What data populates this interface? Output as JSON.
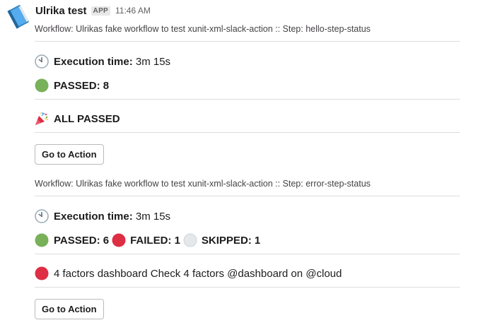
{
  "header": {
    "sender": "Ulrika test",
    "badge": "APP",
    "timestamp": "11:46 AM"
  },
  "sections": [
    {
      "context": "Workflow: Ulrikas fake workflow to test xunit-xml-slack-action :: Step: hello-step-status",
      "execution_label": "Execution time:",
      "execution_value": "3m 15s",
      "passed": "PASSED: 8",
      "summary": "ALL PASSED",
      "button": "Go to Action"
    },
    {
      "context": "Workflow: Ulrikas fake workflow to test xunit-xml-slack-action :: Step: error-step-status",
      "execution_label": "Execution time:",
      "execution_value": "3m 15s",
      "passed": "PASSED: 6",
      "failed": "FAILED: 1",
      "skipped": "SKIPPED: 1",
      "failure": "4 factors dashboard Check 4 factors @dashboard on @cloud",
      "button": "Go to Action"
    }
  ],
  "icons": {
    "avatar": "blue-notebook-icon",
    "clock": "clock-icon",
    "passed": "green-circle-icon",
    "failed": "red-circle-icon",
    "skipped": "white-circle-icon",
    "celebrate": "party-popper-icon"
  },
  "colors": {
    "passed": "#78b159",
    "failed": "#dd2e44",
    "skipped": "#e6e7e8",
    "divider": "#dddddd"
  }
}
